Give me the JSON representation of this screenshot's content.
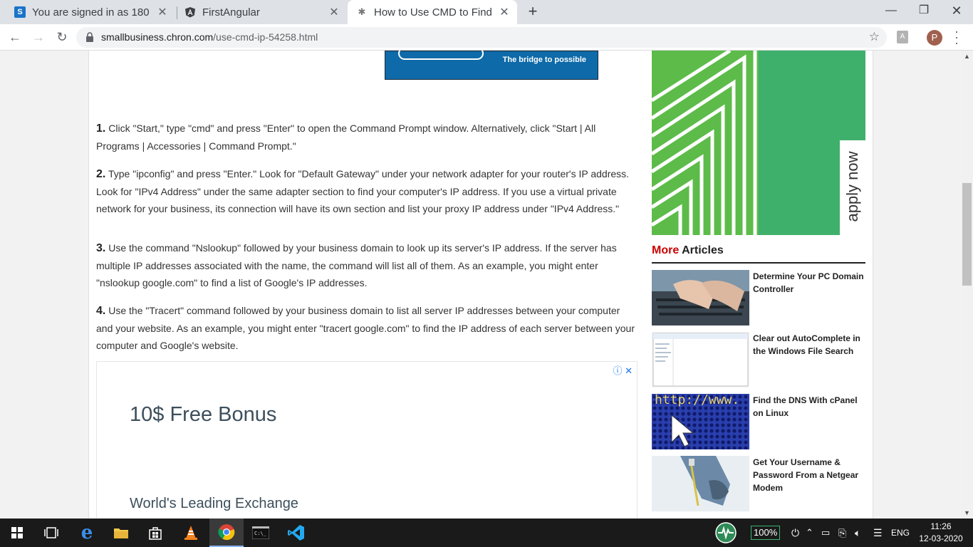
{
  "browser": {
    "tabs": [
      {
        "title": "You are signed in as 180",
        "favicon": "s-icon",
        "active": false
      },
      {
        "title": "FirstAngular",
        "favicon": "angular-icon",
        "active": false
      },
      {
        "title": "How to Use CMD to Find",
        "favicon": "chron-icon",
        "active": true
      }
    ],
    "new_tab": "+",
    "url_host": "smallbusiness.chron.com",
    "url_path": "/use-cmd-ip-54258.html",
    "profile_initial": "P",
    "pdf_label": "A"
  },
  "top_ad": {
    "tagline": "The bridge to possible"
  },
  "steps": [
    {
      "num": "1.",
      "text": " Click \"Start,\" type \"cmd\" and press \"Enter\" to open the Command Prompt window. Alternatively, click \"Start | All Programs | Accessories | Command Prompt.\""
    },
    {
      "num": "2.",
      "text": " Type \"ipconfig\" and press \"Enter.\" Look for \"Default Gateway\" under your network adapter for your router's IP address. Look for \"IPv4 Address\" under the same adapter section to find your computer's IP address. If you use a virtual private network for your business, its connection will have its own section and list your proxy IP address under \"IPv4 Address.\""
    },
    {
      "num": "3.",
      "text": " Use the command \"Nslookup\" followed by your business domain to look up its server's IP address. If the server has multiple IP addresses associated with the name, the command will list all of them. As an example, you might enter \"nslookup google.com\" to find a list of Google's IP addresses."
    },
    {
      "num": "4.",
      "text": " Use the \"Tracert\" command followed by your business domain to list all server IP addresses between your computer and your website. As an example, you might enter \"tracert google.com\" to find the IP address of each server between your computer and Google's website."
    }
  ],
  "ad_box": {
    "headline": "10$ Free Bonus",
    "subline": "World's Leading Exchange",
    "choices": "ⓘ ✕"
  },
  "sidebar": {
    "ad_cta": "apply now",
    "more_red": "More",
    "more_rest": " Articles",
    "articles": [
      {
        "title": "Determine Your PC Domain Controller"
      },
      {
        "title": "Clear out AutoComplete in the Windows File Search"
      },
      {
        "title": "Find the DNS With cPanel on Linux"
      },
      {
        "title": "Get Your Username & Password From a Netgear Modem"
      }
    ],
    "thumb3_text": "http://www."
  },
  "taskbar": {
    "battery": "100%",
    "lang": "ENG",
    "time": "11:26",
    "date": "12-03-2020"
  }
}
